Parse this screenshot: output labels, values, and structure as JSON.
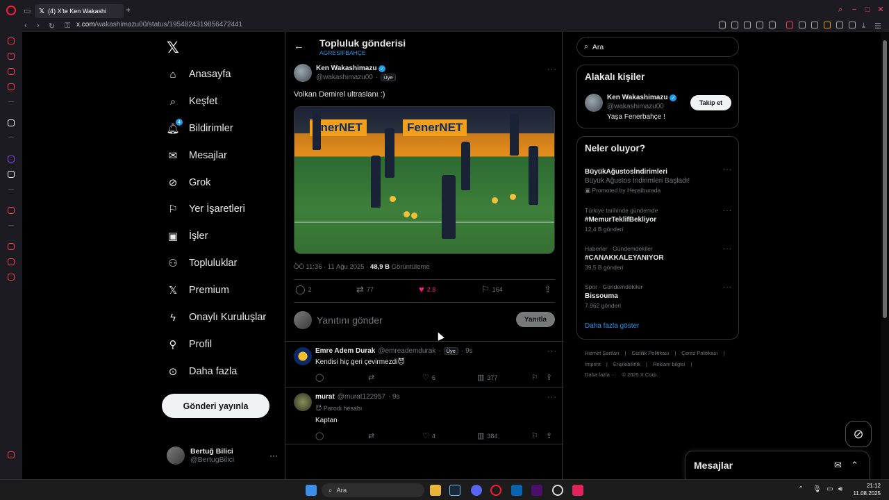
{
  "browser": {
    "tab_title": "(4) X'te Ken Wakashi",
    "url_domain": "x.com",
    "url_path": "/wakashimazu00/status/1954824319856472441"
  },
  "nav": {
    "items": [
      {
        "label": "Anasayfa",
        "icon": "home-icon"
      },
      {
        "label": "Keşfet",
        "icon": "search-icon"
      },
      {
        "label": "Bildirimler",
        "icon": "bell-icon",
        "badge": "4"
      },
      {
        "label": "Mesajlar",
        "icon": "mail-icon"
      },
      {
        "label": "Grok",
        "icon": "grok-icon"
      },
      {
        "label": "Yer İşaretleri",
        "icon": "bookmark-icon"
      },
      {
        "label": "İşler",
        "icon": "briefcase-icon"
      },
      {
        "label": "Topluluklar",
        "icon": "people-icon"
      },
      {
        "label": "Premium",
        "icon": "x-icon"
      },
      {
        "label": "Onaylı Kuruluşlar",
        "icon": "lightning-icon"
      },
      {
        "label": "Profil",
        "icon": "user-icon"
      },
      {
        "label": "Daha fazla",
        "icon": "more-circle-icon"
      }
    ],
    "post_button": "Gönderi yayınla",
    "me": {
      "name": "Bertuğ Bilici",
      "handle": "@BertugBilici"
    }
  },
  "header": {
    "title": "Topluluk gönderisi",
    "subtitle": "AGRESIFBAHÇE"
  },
  "post": {
    "author_name": "Ken Wakashimazu",
    "author_handle": "@wakashimazu00",
    "member_label": "Üye",
    "text": "Volkan Demirel ultraslanı :)",
    "media_banner_left": "enerNET",
    "media_banner_right": "FenerNET",
    "time": "ÖÖ 11:36 · 11 Ağu 2025 · ",
    "views_count": "48,9 B",
    "views_label": " Görüntüleme",
    "replies": "2",
    "reposts": "77",
    "likes": "2.8",
    "bookmarks": "164"
  },
  "reply_box": {
    "placeholder": "Yanıtını gönder",
    "button": "Yanıtla"
  },
  "replies": [
    {
      "name": "Emre Adem Durak",
      "handle": "@emreademdurak",
      "member": "Üye",
      "time": "· 9s",
      "text": "Kendisi hiç geri çevirmezdi😈",
      "sub": "",
      "comments": "",
      "likes": "6",
      "views": "377"
    },
    {
      "name": "murat",
      "handle": "@murat122957",
      "member": "",
      "time": "· 9s",
      "sub": "😈 Parodi hesabı",
      "text": "Kaptan",
      "comments": "",
      "likes": "4",
      "views": "384"
    }
  ],
  "search": {
    "placeholder": "Ara"
  },
  "related": {
    "title": "Alakalı kişiler",
    "name": "Ken Wakashimazu",
    "handle": "@wakashimazu00",
    "bio": "Yaşa Fenerbahçe !",
    "follow": "Takip et"
  },
  "trends": {
    "title": "Neler oluyor?",
    "items": [
      {
        "category": "",
        "name": "BüyükAğustosİndirimleri",
        "sub": "Büyük Ağustos İndirimleri Başladı!",
        "count": "Promoted by Hepsiburada"
      },
      {
        "category": "Türkiye tarihinde gündemde",
        "name": "#MemurTeklifBekliyor",
        "sub": "",
        "count": "12,4 B gönderi"
      },
      {
        "category": "Haberler · Gündemdekiler",
        "name": "#CANAKKALEYANIYOR",
        "sub": "",
        "count": "39,5 B gönderi"
      },
      {
        "category": "Spor · Gündemdekiler",
        "name": "Bissouma",
        "sub": "",
        "count": "7.962 gönderi"
      }
    ],
    "show_more": "Daha fazla göster"
  },
  "footer": {
    "links": [
      "Hizmet Şartları",
      "|",
      "Gizlilik Politikası",
      "|",
      "Çerez Politikası",
      "|",
      "İmprint",
      "|",
      "Erişilebilirlik",
      "|",
      "Reklam bilgisi",
      "|",
      "Daha fazla ···",
      "© 2025 X Corp."
    ]
  },
  "messages_dock": {
    "title": "Mesajlar"
  },
  "taskbar": {
    "search": "Ara",
    "time": "21:12",
    "date": "11.08.2025"
  }
}
